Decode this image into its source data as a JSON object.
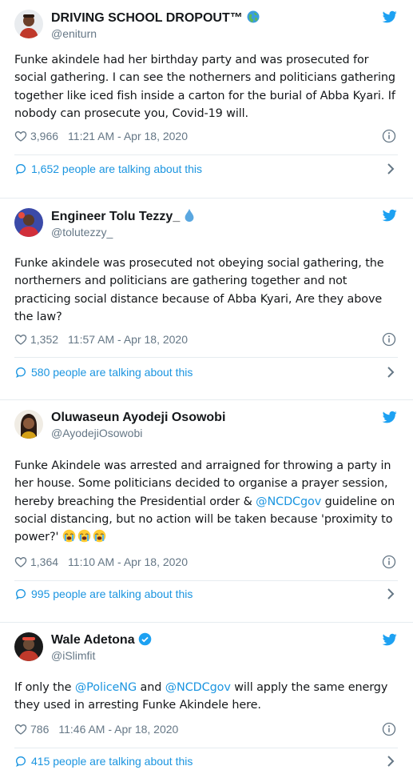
{
  "tweets": [
    {
      "name": "DRIVING SCHOOL DROPOUT™",
      "handle": "@eniturn",
      "text": "Funke akindele had her birthday party and was prosecuted for social gathering. I can see the notherners and politicians gathering together like  iced fish inside a carton for the burial of Abba Kyari. If nobody can prosecute you, Covid-19 will.",
      "likes": "3,966",
      "timestamp": "11:21 AM - Apr 18, 2020",
      "talking": "1,652 people are talking about this"
    },
    {
      "name": "Engineer Tolu Tezzy_",
      "handle": "@tolutezzy_",
      "text": "Funke akindele was prosecuted not obeying social gathering, the northerners and politicians are gathering together and not practicing social distance because of Abba Kyari, Are they above the law?",
      "likes": "1,352",
      "timestamp": "11:57 AM - Apr 18, 2020",
      "talking": "580 people are talking about this"
    },
    {
      "name": "Oluwaseun Ayodeji Osowobi",
      "handle": "@AyodejiOsowobi",
      "text_a": "Funke Akindele was arrested and arraigned for throwing a party in her house. Some politicians decided to organise a prayer session, hereby breaching the Presidential order & ",
      "mention": "@NCDCgov",
      "text_b": " guideline on social distancing, but no action will be taken because 'proximity to power?' ",
      "likes": "1,364",
      "timestamp": "11:10 AM - Apr 18, 2020",
      "talking": "995 people are talking about this"
    },
    {
      "name": "Wale Adetona",
      "handle": "@iSlimfit",
      "text_a": "If only the ",
      "mention_1": "@PoliceNG",
      "text_b": " and ",
      "mention_2": "@NCDCgov",
      "text_c": " will apply the same energy they used in arresting Funke Akindele here.",
      "likes": "786",
      "timestamp": "11:46 AM - Apr 18, 2020",
      "talking": "415 people are talking about this"
    }
  ],
  "icons": {
    "brand": "twitter-bird-icon",
    "like": "heart-icon",
    "info": "info-icon",
    "reply": "speech-bubble-icon",
    "more": "chevron-right-icon",
    "globe": "globe-icon",
    "drop": "water-drop-icon",
    "verified": "verified-badge-icon",
    "crying": "loudly-crying-face-icon"
  },
  "colors": {
    "link": "#1b95e0",
    "text": "#14171a",
    "muted": "#657786",
    "divider": "#e6ecf0"
  }
}
